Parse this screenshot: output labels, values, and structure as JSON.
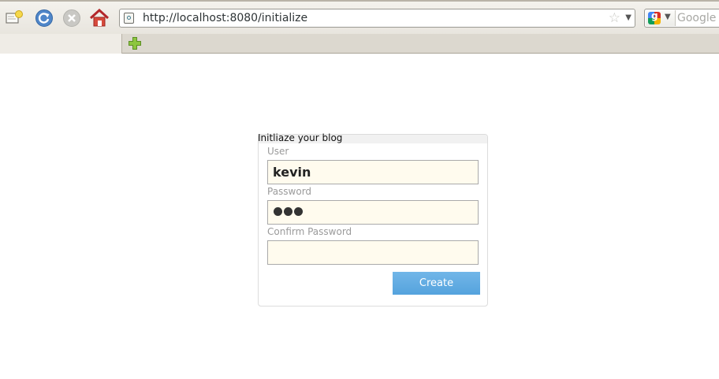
{
  "browser": {
    "url": "http://localhost:8080/initialize",
    "search_placeholder": "Google"
  },
  "form": {
    "legend": "Initliaze your blog",
    "fields": [
      {
        "label": "User",
        "value": "kevin"
      },
      {
        "label": "Password",
        "value": "•••"
      },
      {
        "label": "Confirm Password",
        "value": ""
      }
    ],
    "submit_label": "Create"
  },
  "colors": {
    "field_background": "#fffbee",
    "button_color": "#5fabe2"
  }
}
